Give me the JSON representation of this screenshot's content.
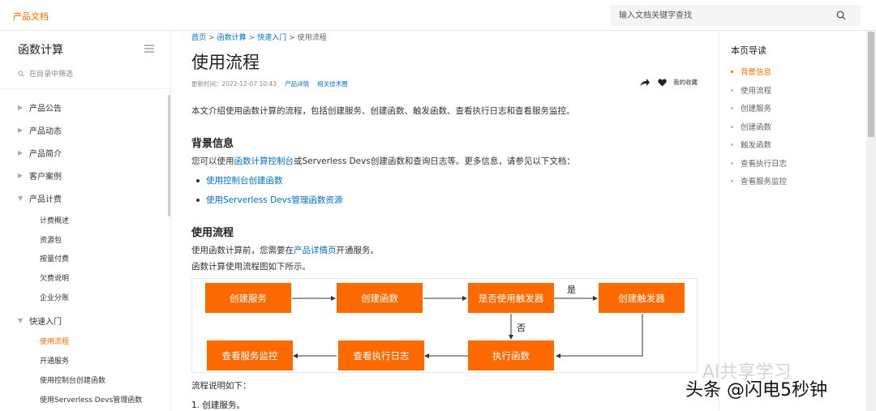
{
  "topbar": {
    "brand": "产品文档",
    "search_placeholder": "输入文档关键字查找",
    "search_icon": "search-icon"
  },
  "sidebar": {
    "title": "函数计算",
    "filter_placeholder": "在目录中筛选",
    "items": [
      {
        "label": "产品公告",
        "level": 1,
        "expanded": false
      },
      {
        "label": "产品动态",
        "level": 1,
        "expanded": false
      },
      {
        "label": "产品简介",
        "level": 1,
        "expanded": false
      },
      {
        "label": "客户案例",
        "level": 1,
        "expanded": false
      },
      {
        "label": "产品计费",
        "level": 1,
        "expanded": true
      },
      {
        "label": "计费概述",
        "level": 2
      },
      {
        "label": "资源包",
        "level": 2
      },
      {
        "label": "按量付费",
        "level": 2
      },
      {
        "label": "欠费说明",
        "level": 2
      },
      {
        "label": "企业分账",
        "level": 2
      },
      {
        "label": "快速入门",
        "level": 1,
        "expanded": true
      },
      {
        "label": "使用流程",
        "level": 2,
        "active": true
      },
      {
        "label": "开通服务",
        "level": 2
      },
      {
        "label": "使用控制台创建函数",
        "level": 2
      },
      {
        "label": "使用Serverless Devs管理函数",
        "level": 2
      }
    ]
  },
  "breadcrumb": {
    "items": [
      "首页",
      "函数计算",
      "快速入门",
      "使用流程"
    ],
    "separator": ">"
  },
  "page": {
    "title": "使用流程",
    "updated": "更新时间：2022-12-07 10:43",
    "links": [
      "产品详情",
      "相关技术圈"
    ],
    "favorite_label": "我的收藏",
    "intro": "本文介绍使用函数计算的流程，包括创建服务、创建函数、触发函数、查看执行日志和查看服务监控。",
    "section1": {
      "heading": "背景信息",
      "text_before": "您可以使用",
      "link": "函数计算控制台",
      "text_after": "或Serverless Devs创建函数和查询日志等。更多信息，请参见以下文档：",
      "bullets": [
        "使用控制台创建函数",
        "使用Serverless Devs管理函数资源"
      ]
    },
    "section2": {
      "heading": "使用流程",
      "text_before": "使用函数计算前，您需要在",
      "link": "产品详情页",
      "text_after": "开通服务。",
      "text2": "函数计算使用流程图如下所示。",
      "flow_intro": "流程说明如下：",
      "step1": "1. 创建服务。"
    },
    "flow": {
      "boxes": [
        "创建服务",
        "创建函数",
        "是否使用触发器",
        "创建触发器",
        "执行函数",
        "查看执行日志",
        "查看服务监控"
      ],
      "yes": "是",
      "no": "否"
    }
  },
  "toc": {
    "title": "本页导读",
    "items": [
      "背景信息",
      "使用流程",
      "创建服务",
      "创建函数",
      "触发函数",
      "查看执行日志",
      "查看服务监控"
    ],
    "active_index": 0
  },
  "watermark": {
    "line1": "AI共享学习",
    "line2": "头条 @闪电5秒钟"
  },
  "colors": {
    "accent": "#ff6a00",
    "link": "#0070cc"
  }
}
